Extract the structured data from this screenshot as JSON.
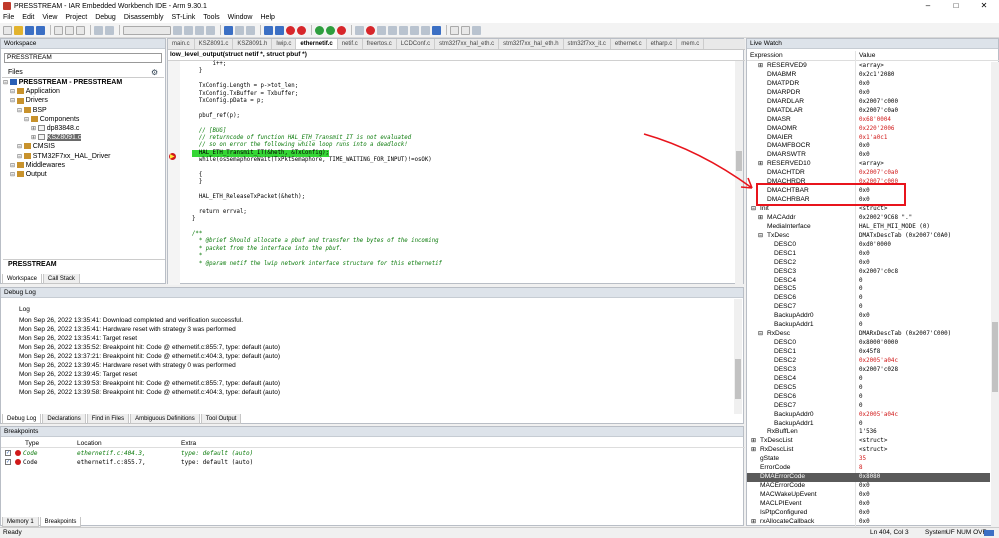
{
  "window": {
    "title": "PRESSTREAM - IAR Embedded Workbench IDE - Arm 9.30.1"
  },
  "menu": [
    "File",
    "Edit",
    "View",
    "Project",
    "Debug",
    "Disassembly",
    "ST-Link",
    "Tools",
    "Window",
    "Help"
  ],
  "workspace": {
    "title": "Workspace",
    "selector": "PRESSTREAM",
    "files_label": "Files",
    "tree": [
      {
        "label": "PRESSTREAM - PRESSTREAM",
        "level": 0,
        "bold": true
      },
      {
        "label": "Application",
        "level": 1
      },
      {
        "label": "Drivers",
        "level": 1
      },
      {
        "label": "BSP",
        "level": 2
      },
      {
        "label": "Components",
        "level": 3
      },
      {
        "label": "dp83848.c",
        "level": 4
      },
      {
        "label": "KSZ8091.c",
        "level": 4,
        "selected": true
      },
      {
        "label": "CMSIS",
        "level": 2
      },
      {
        "label": "STM32F7xx_HAL_Driver",
        "level": 2
      },
      {
        "label": "Middlewares",
        "level": 1
      },
      {
        "label": "Output",
        "level": 1
      }
    ],
    "bottom_label": "PRESSTREAM",
    "tabs": [
      "Workspace",
      "Call Stack"
    ]
  },
  "editor": {
    "tabs": [
      "main.c",
      "KSZ8091.c",
      "KSZ8091.h",
      "lwip.c",
      "ethernetif.c",
      "netif.c",
      "freertos.c",
      "LCDConf.c",
      "stm32f7xx_hal_eth.c",
      "stm32f7xx_hal_eth.h",
      "stm32f7xx_it.c",
      "ethernet.c",
      "etharp.c",
      "mem.c"
    ],
    "active_tab": "ethernetif.c",
    "function_bar": "low_level_output(struct netif *, struct pbuf *)",
    "lines": [
      {
        "text": "      i++;",
        "cls": ""
      },
      {
        "text": "  }",
        "cls": ""
      },
      {
        "text": "",
        "cls": ""
      },
      {
        "text": "  TxConfig.Length = p->tot_len;",
        "cls": ""
      },
      {
        "text": "  TxConfig.TxBuffer = Txbuffer;",
        "cls": ""
      },
      {
        "text": "  TxConfig.pData = p;",
        "cls": ""
      },
      {
        "text": "",
        "cls": ""
      },
      {
        "text": "  pbuf_ref(p);",
        "cls": ""
      },
      {
        "text": "",
        "cls": ""
      },
      {
        "text": "  // [BUG]",
        "cls": "cm"
      },
      {
        "text": "  // returncode of function HAL_ETH_Transmit_IT is not evaluated",
        "cls": "cm"
      },
      {
        "text": "  // so on error the following while loop runs into a deadlock!",
        "cls": "cm"
      },
      {
        "text": "  HAL_ETH_Transmit_IT(&heth, &TxConfig);",
        "cls": "hl"
      },
      {
        "text": "  while(osSemaphoreWait(TxPktSemaphore, TIME_WAITING_FOR_INPUT)!=osOK)",
        "cls": ""
      },
      {
        "text": "",
        "cls": ""
      },
      {
        "text": "  {",
        "cls": ""
      },
      {
        "text": "  }",
        "cls": ""
      },
      {
        "text": "",
        "cls": ""
      },
      {
        "text": "  HAL_ETH_ReleaseTxPacket(&heth);",
        "cls": ""
      },
      {
        "text": "",
        "cls": ""
      },
      {
        "text": "  return errval;",
        "cls": ""
      },
      {
        "text": "}",
        "cls": ""
      },
      {
        "text": "",
        "cls": ""
      },
      {
        "text": "/**",
        "cls": "cm"
      },
      {
        "text": "  * @brief Should allocate a pbuf and transfer the bytes of the incoming",
        "cls": "cm"
      },
      {
        "text": "  * packet from the interface into the pbuf.",
        "cls": "cm"
      },
      {
        "text": "  *",
        "cls": "cm"
      },
      {
        "text": "  * @param netif the lwip network interface structure for this ethernetif",
        "cls": "cm"
      }
    ]
  },
  "debug_log": {
    "title": "Debug Log",
    "header": "Log",
    "lines": [
      "Mon Sep 26, 2022 13:35:41: Download completed and verification successful.",
      "Mon Sep 26, 2022 13:35:41: Hardware reset with strategy 3 was performed",
      "Mon Sep 26, 2022 13:35:41: Target reset",
      "Mon Sep 26, 2022 13:35:52: Breakpoint hit: Code @ ethernetif.c:855:7, type: default (auto)",
      "Mon Sep 26, 2022 13:37:21: Breakpoint hit: Code @ ethernetif.c:404:3, type: default (auto)",
      "Mon Sep 26, 2022 13:39:45: Hardware reset with strategy 0 was performed",
      "Mon Sep 26, 2022 13:39:45: Target reset",
      "Mon Sep 26, 2022 13:39:53: Breakpoint hit: Code @ ethernetif.c:855:7, type: default (auto)",
      "Mon Sep 26, 2022 13:39:58: Breakpoint hit: Code @ ethernetif.c:404:3, type: default (auto)"
    ],
    "tabs": [
      "Debug Log",
      "Declarations",
      "Find in Files",
      "Ambiguous Definitions",
      "Tool Output"
    ]
  },
  "breakpoints": {
    "title": "Breakpoints",
    "columns": [
      "Type",
      "Location",
      "Extra"
    ],
    "rows": [
      {
        "type": "Code",
        "location": "ethernetif.c:404.3,",
        "extra": "type: default (auto)",
        "active": true
      },
      {
        "type": "Code",
        "location": "ethernetif.c:855.7,",
        "extra": "type: default (auto)",
        "active": false
      }
    ],
    "tabs": [
      "Memory 1",
      "Breakpoints"
    ]
  },
  "watch": {
    "title": "Live Watch",
    "columns": [
      "Expression",
      "Value"
    ],
    "rows": [
      {
        "name": "RESERVED9",
        "value": "<array>",
        "indent": 2,
        "exp": "+"
      },
      {
        "name": "DMABMR",
        "value": "0x2c1'2080",
        "indent": 2
      },
      {
        "name": "DMATPDR",
        "value": "0x0",
        "indent": 2
      },
      {
        "name": "DMARPDR",
        "value": "0x0",
        "indent": 2
      },
      {
        "name": "DMARDLAR",
        "value": "0x2007'c000",
        "indent": 2
      },
      {
        "name": "DMATDLAR",
        "value": "0x2007'c0a0",
        "indent": 2
      },
      {
        "name": "DMASR",
        "value": "0x68'0004",
        "indent": 2,
        "red": true
      },
      {
        "name": "DMAOMR",
        "value": "0x220'2006",
        "indent": 2,
        "red": true
      },
      {
        "name": "DMAIER",
        "value": "0x1'a0c1",
        "indent": 2,
        "red": true
      },
      {
        "name": "DMAMFBOCR",
        "value": "0x0",
        "indent": 2
      },
      {
        "name": "DMARSWTR",
        "value": "0x0",
        "indent": 2
      },
      {
        "name": "RESERVED10",
        "value": "<array>",
        "indent": 2,
        "exp": "+"
      },
      {
        "name": "DMACHTDR",
        "value": "0x2007'c0a0",
        "indent": 2,
        "red": true
      },
      {
        "name": "DMACHRDR",
        "value": "0x2007'c000",
        "indent": 2,
        "red": true
      },
      {
        "name": "DMACHTBAR",
        "value": "0x0",
        "indent": 2,
        "boxed": true
      },
      {
        "name": "DMACHRBAR",
        "value": "0x0",
        "indent": 2,
        "boxed": true
      },
      {
        "name": "Init",
        "value": "<struct>",
        "indent": 1,
        "exp": "-"
      },
      {
        "name": "MACAddr",
        "value": "0x2002'9C68 \".\"",
        "indent": 2,
        "exp": "+"
      },
      {
        "name": "MediaInterface",
        "value": "HAL_ETH_MII_MODE (0)",
        "indent": 2
      },
      {
        "name": "TxDesc",
        "value": "DMATxDescTab (0x2007'C0A0)",
        "indent": 2,
        "exp": "-"
      },
      {
        "name": "DESC0",
        "value": "0xd0'0000",
        "indent": 3
      },
      {
        "name": "DESC1",
        "value": "0x0",
        "indent": 3
      },
      {
        "name": "DESC2",
        "value": "0x0",
        "indent": 3
      },
      {
        "name": "DESC3",
        "value": "0x2007'c0c8",
        "indent": 3
      },
      {
        "name": "DESC4",
        "value": "0",
        "indent": 3
      },
      {
        "name": "DESC5",
        "value": "0",
        "indent": 3
      },
      {
        "name": "DESC6",
        "value": "0",
        "indent": 3
      },
      {
        "name": "DESC7",
        "value": "0",
        "indent": 3
      },
      {
        "name": "BackupAddr0",
        "value": "0x0",
        "indent": 3
      },
      {
        "name": "BackupAddr1",
        "value": "0",
        "indent": 3
      },
      {
        "name": "RxDesc",
        "value": "DMARxDescTab (0x2007'C000)",
        "indent": 2,
        "exp": "-"
      },
      {
        "name": "DESC0",
        "value": "0x8000'0000",
        "indent": 3
      },
      {
        "name": "DESC1",
        "value": "0x45f8",
        "indent": 3
      },
      {
        "name": "DESC2",
        "value": "0x2005'a04c",
        "indent": 3,
        "red": true
      },
      {
        "name": "DESC3",
        "value": "0x2007'c028",
        "indent": 3
      },
      {
        "name": "DESC4",
        "value": "0",
        "indent": 3
      },
      {
        "name": "DESC5",
        "value": "0",
        "indent": 3
      },
      {
        "name": "DESC6",
        "value": "0",
        "indent": 3
      },
      {
        "name": "DESC7",
        "value": "0",
        "indent": 3
      },
      {
        "name": "BackupAddr0",
        "value": "0x2005'a04c",
        "indent": 3,
        "red": true
      },
      {
        "name": "BackupAddr1",
        "value": "0",
        "indent": 3
      },
      {
        "name": "RxBuffLen",
        "value": "1'536",
        "indent": 2
      },
      {
        "name": "TxDescList",
        "value": "<struct>",
        "indent": 1,
        "exp": "+"
      },
      {
        "name": "RxDescList",
        "value": "<struct>",
        "indent": 1,
        "exp": "+"
      },
      {
        "name": "gState",
        "value": "35",
        "indent": 1,
        "red": true
      },
      {
        "name": "ErrorCode",
        "value": "8",
        "indent": 1,
        "red": true
      },
      {
        "name": "DMAErrorCode",
        "value": "0x8080",
        "indent": 1,
        "sel": true
      },
      {
        "name": "MACErrorCode",
        "value": "0x0",
        "indent": 1
      },
      {
        "name": "MACWakeUpEvent",
        "value": "0x0",
        "indent": 1
      },
      {
        "name": "MACLPIEvent",
        "value": "0x0",
        "indent": 1
      },
      {
        "name": "IsPtpConfigured",
        "value": "0x0",
        "indent": 1
      },
      {
        "name": "rxAllocateCallback",
        "value": "0x0",
        "indent": 1,
        "exp": "+"
      }
    ]
  },
  "status": {
    "left": "Ready",
    "position": "Ln 404, Col 3",
    "encoding": "System",
    "mode": "UF NUM OVR"
  },
  "colors": {
    "annotation_red": "#e8141c",
    "highlight_green": "#35d635",
    "selected_row": "#5a5a5a"
  }
}
